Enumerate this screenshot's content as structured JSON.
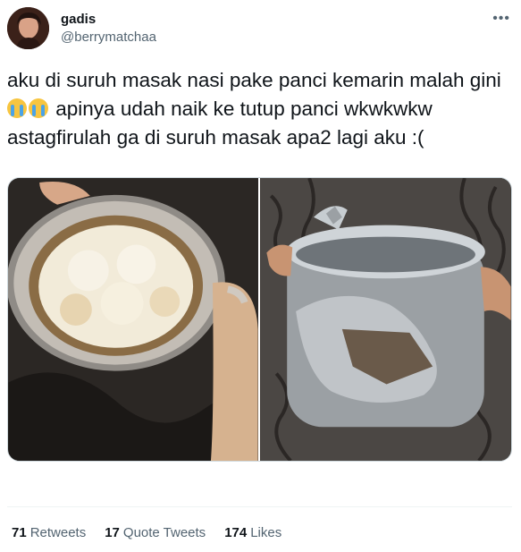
{
  "user": {
    "name": "gadis",
    "handle": "@berrymatchaa"
  },
  "tweet": {
    "line1": "aku di suruh masak nasi pake panci kemarin malah gini",
    "line2": "apinya udah naik ke tutup panci wkwkwkw",
    "line3": "astagfirulah ga di suruh masak apa2 lagi aku :(",
    "emoji": "loudly-crying-face"
  },
  "stats": {
    "retweets_count": "71",
    "retweets_label": "Retweets",
    "quotes_count": "17",
    "quotes_label": "Quote Tweets",
    "likes_count": "174",
    "likes_label": "Likes"
  },
  "icons": {
    "more": "more-icon"
  }
}
